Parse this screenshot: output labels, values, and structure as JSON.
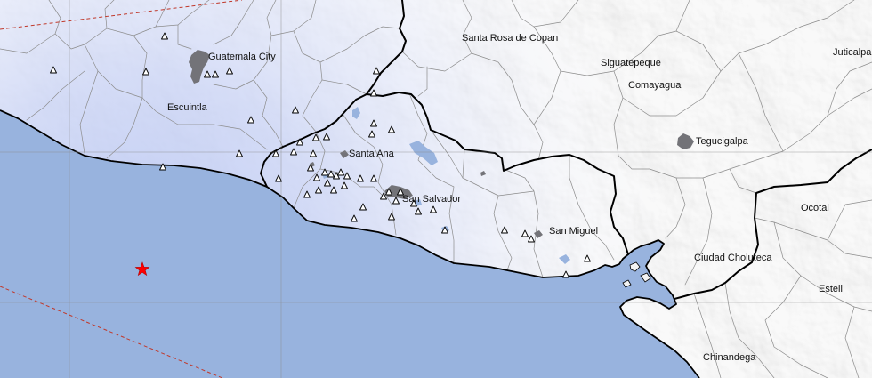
{
  "map": {
    "labels": {
      "guatemala_city": "Guatemala City",
      "escuintla": "Escuintla",
      "santa_rosa_de_copan": "Santa Rosa de Copan",
      "siguatepeque": "Siguatepeque",
      "comayagua": "Comayagua",
      "juticalpa": "Juticalpa",
      "tegucigalpa": "Tegucigalpa",
      "santa_ana": "Santa Ana",
      "san_salvador": "San Salvador",
      "san_miguel": "San Miguel",
      "ocotal": "Ocotal",
      "ciudad_choluteca": "Ciudad Choluteca",
      "esteli": "Esteli",
      "chinandega": "Chinandega"
    },
    "markers": {
      "epicenter_icon": "star-icon",
      "station_icon": "triangle-icon"
    },
    "colors": {
      "ocean": "#98b3de",
      "lake": "#98b3de",
      "land": "#f3f3f3",
      "intensity_tint": "#b9c6f0",
      "urban_area": "#737378",
      "coastline": "#000000",
      "national_border": "#000000",
      "admin_boundary": "#8c8c8c",
      "graticule": "#8a8a8a",
      "fault_line": "#c0392b",
      "epicenter": "#ff0000",
      "station_fill": "#ffffff",
      "station_stroke": "#000000",
      "label_text": "#111111"
    }
  }
}
